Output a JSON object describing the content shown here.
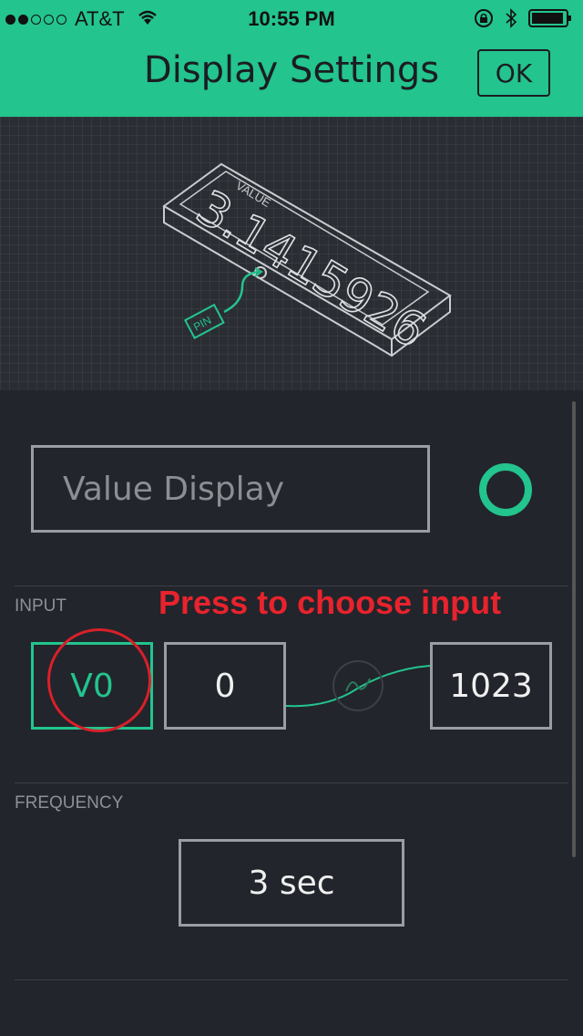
{
  "status_bar": {
    "carrier": "AT&T",
    "time": "10:55 PM",
    "signal_bars_filled": 2,
    "signal_bars_total": 5
  },
  "header": {
    "title": "Display Settings",
    "ok_label": "OK"
  },
  "preview": {
    "widget_label": "VALUE",
    "widget_value": "3.1415926",
    "pin_label": "PIN"
  },
  "widget_name": {
    "placeholder": "Value Display"
  },
  "input_section": {
    "label": "INPUT",
    "pin": "V0",
    "min": "0",
    "max": "1023"
  },
  "annotation": "Press to choose input",
  "frequency_section": {
    "label": "FREQUENCY",
    "value": "3 sec"
  },
  "colors": {
    "accent": "#23c48e",
    "background": "#22252b",
    "annotation": "#e8232d"
  },
  "icons": [
    "wifi-icon",
    "orientation-lock-icon",
    "bluetooth-icon",
    "battery-icon",
    "wave-icon"
  ]
}
